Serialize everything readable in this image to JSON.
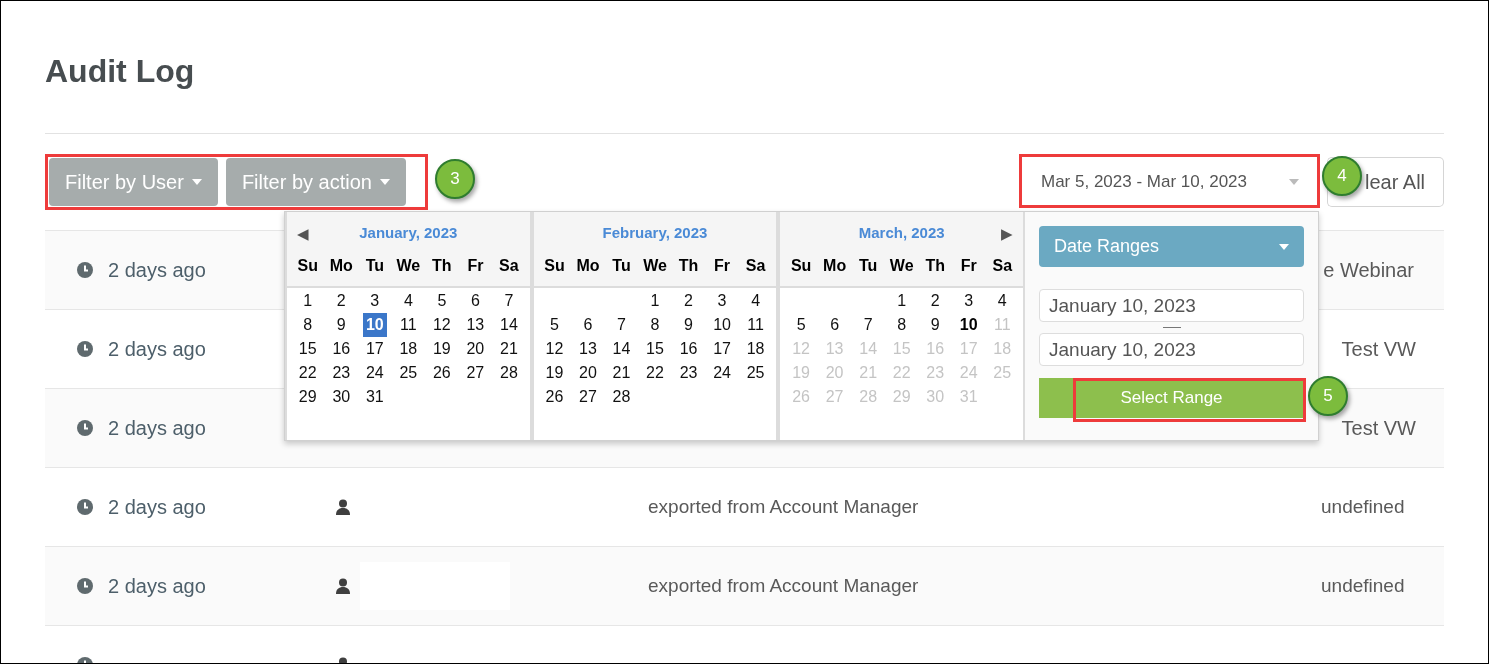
{
  "page": {
    "title": "Audit Log"
  },
  "toolbar": {
    "filters": [
      {
        "label": "Filter by User"
      },
      {
        "label": "Filter by action"
      }
    ],
    "date_range": {
      "value": "Mar 5, 2023 - Mar 10, 2023"
    },
    "clear_button": {
      "label": "lear All"
    }
  },
  "rows": [
    {
      "time": "2 days ago",
      "kind": "covered",
      "value": "e Webinar"
    },
    {
      "time": "2 days ago",
      "kind": "covered",
      "value": "Test VW"
    },
    {
      "time": "2 days ago",
      "kind": "covered",
      "value": "Test VW"
    },
    {
      "time": "2 days ago",
      "kind": "full",
      "action": "exported from Account Manager",
      "value": "undefined"
    },
    {
      "time": "2 days ago",
      "kind": "full",
      "action": "exported from Account Manager",
      "value": "undefined"
    },
    {
      "kind": "cut"
    }
  ],
  "date_picker": {
    "months": [
      {
        "title": "January, 2023",
        "prev": "◀",
        "weekdays": [
          "Su",
          "Mo",
          "Tu",
          "We",
          "Th",
          "Fr",
          "Sa"
        ],
        "weeks": [
          [
            {
              "kind": "day",
              "label": "1",
              "selected": false
            },
            {
              "kind": "day",
              "label": "2",
              "selected": false
            },
            {
              "kind": "day",
              "label": "3",
              "selected": false
            },
            {
              "kind": "day",
              "label": "4",
              "selected": false
            },
            {
              "kind": "day",
              "label": "5",
              "selected": false
            },
            {
              "kind": "day",
              "label": "6",
              "selected": false
            },
            {
              "kind": "day",
              "label": "7",
              "selected": false
            }
          ],
          [
            {
              "kind": "day",
              "label": "8",
              "selected": false
            },
            {
              "kind": "day",
              "label": "9",
              "selected": false
            },
            {
              "kind": "day",
              "label": "10",
              "selected": true
            },
            {
              "kind": "day",
              "label": "11",
              "selected": false
            },
            {
              "kind": "day",
              "label": "12",
              "selected": false
            },
            {
              "kind": "day",
              "label": "13",
              "selected": false
            },
            {
              "kind": "day",
              "label": "14",
              "selected": false
            }
          ],
          [
            {
              "kind": "day",
              "label": "15",
              "selected": false
            },
            {
              "kind": "day",
              "label": "16",
              "selected": false
            },
            {
              "kind": "day",
              "label": "17",
              "selected": false
            },
            {
              "kind": "day",
              "label": "18",
              "selected": false
            },
            {
              "kind": "day",
              "label": "19",
              "selected": false
            },
            {
              "kind": "day",
              "label": "20",
              "selected": false
            },
            {
              "kind": "day",
              "label": "21",
              "selected": false
            }
          ],
          [
            {
              "kind": "day",
              "label": "22",
              "selected": false
            },
            {
              "kind": "day",
              "label": "23",
              "selected": false
            },
            {
              "kind": "day",
              "label": "24",
              "selected": false
            },
            {
              "kind": "day",
              "label": "25",
              "selected": false
            },
            {
              "kind": "day",
              "label": "26",
              "selected": false
            },
            {
              "kind": "day",
              "label": "27",
              "selected": false
            },
            {
              "kind": "day",
              "label": "28",
              "selected": false
            }
          ],
          [
            {
              "kind": "day",
              "label": "29",
              "selected": false
            },
            {
              "kind": "day",
              "label": "30",
              "selected": false
            },
            {
              "kind": "day",
              "label": "31",
              "selected": false
            }
          ]
        ]
      },
      {
        "title": "February, 2023",
        "weekdays": [
          "Su",
          "Mo",
          "Tu",
          "We",
          "Th",
          "Fr",
          "Sa"
        ],
        "weeks": [
          [
            {
              "kind": "blank"
            },
            {
              "kind": "blank"
            },
            {
              "kind": "blank"
            },
            {
              "kind": "day",
              "label": "1",
              "selected": false
            },
            {
              "kind": "day",
              "label": "2",
              "selected": false
            },
            {
              "kind": "day",
              "label": "3",
              "selected": false
            },
            {
              "kind": "day",
              "label": "4",
              "selected": false
            }
          ],
          [
            {
              "kind": "day",
              "label": "5",
              "selected": false
            },
            {
              "kind": "day",
              "label": "6",
              "selected": false
            },
            {
              "kind": "day",
              "label": "7",
              "selected": false
            },
            {
              "kind": "day",
              "label": "8",
              "selected": false
            },
            {
              "kind": "day",
              "label": "9",
              "selected": false
            },
            {
              "kind": "day",
              "label": "10",
              "selected": false
            },
            {
              "kind": "day",
              "label": "11",
              "selected": false
            }
          ],
          [
            {
              "kind": "day",
              "label": "12",
              "selected": false
            },
            {
              "kind": "day",
              "label": "13",
              "selected": false
            },
            {
              "kind": "day",
              "label": "14",
              "selected": false
            },
            {
              "kind": "day",
              "label": "15",
              "selected": false
            },
            {
              "kind": "day",
              "label": "16",
              "selected": false
            },
            {
              "kind": "day",
              "label": "17",
              "selected": false
            },
            {
              "kind": "day",
              "label": "18",
              "selected": false
            }
          ],
          [
            {
              "kind": "day",
              "label": "19",
              "selected": false
            },
            {
              "kind": "day",
              "label": "20",
              "selected": false
            },
            {
              "kind": "day",
              "label": "21",
              "selected": false
            },
            {
              "kind": "day",
              "label": "22",
              "selected": false
            },
            {
              "kind": "day",
              "label": "23",
              "selected": false
            },
            {
              "kind": "day",
              "label": "24",
              "selected": false
            },
            {
              "kind": "day",
              "label": "25",
              "selected": false
            }
          ],
          [
            {
              "kind": "day",
              "label": "26",
              "selected": false
            },
            {
              "kind": "day",
              "label": "27",
              "selected": false
            },
            {
              "kind": "day",
              "label": "28",
              "selected": false
            }
          ]
        ]
      },
      {
        "title": "March, 2023",
        "next": "▶",
        "weekdays": [
          "Su",
          "Mo",
          "Tu",
          "We",
          "Th",
          "Fr",
          "Sa"
        ],
        "weeks": [
          [
            {
              "kind": "blank"
            },
            {
              "kind": "blank"
            },
            {
              "kind": "blank"
            },
            {
              "kind": "day",
              "label": "1",
              "selected": false
            },
            {
              "kind": "day",
              "label": "2",
              "selected": false
            },
            {
              "kind": "day",
              "label": "3",
              "selected": false
            },
            {
              "kind": "day",
              "label": "4",
              "selected": false
            }
          ],
          [
            {
              "kind": "day",
              "label": "5",
              "selected": false
            },
            {
              "kind": "day",
              "label": "6",
              "selected": false
            },
            {
              "kind": "day",
              "label": "7",
              "selected": false
            },
            {
              "kind": "day",
              "label": "8",
              "selected": false
            },
            {
              "kind": "day",
              "label": "9",
              "selected": false
            },
            {
              "kind": "today",
              "label": "10",
              "selected": false
            },
            {
              "kind": "disabled",
              "label": "11",
              "selected": false
            }
          ],
          [
            {
              "kind": "disabled",
              "label": "12",
              "selected": false
            },
            {
              "kind": "disabled",
              "label": "13",
              "selected": false
            },
            {
              "kind": "disabled",
              "label": "14",
              "selected": false
            },
            {
              "kind": "disabled",
              "label": "15",
              "selected": false
            },
            {
              "kind": "disabled",
              "label": "16",
              "selected": false
            },
            {
              "kind": "disabled",
              "label": "17",
              "selected": false
            },
            {
              "kind": "disabled",
              "label": "18",
              "selected": false
            }
          ],
          [
            {
              "kind": "disabled",
              "label": "19",
              "selected": false
            },
            {
              "kind": "disabled",
              "label": "20",
              "selected": false
            },
            {
              "kind": "disabled",
              "label": "21",
              "selected": false
            },
            {
              "kind": "disabled",
              "label": "22",
              "selected": false
            },
            {
              "kind": "disabled",
              "label": "23",
              "selected": false
            },
            {
              "kind": "disabled",
              "label": "24",
              "selected": false
            },
            {
              "kind": "disabled",
              "label": "25",
              "selected": false
            }
          ],
          [
            {
              "kind": "disabled",
              "label": "26",
              "selected": false
            },
            {
              "kind": "disabled",
              "label": "27",
              "selected": false
            },
            {
              "kind": "disabled",
              "label": "28",
              "selected": false
            },
            {
              "kind": "disabled",
              "label": "29",
              "selected": false
            },
            {
              "kind": "disabled",
              "label": "30",
              "selected": false
            },
            {
              "kind": "disabled",
              "label": "31",
              "selected": false
            }
          ]
        ]
      }
    ],
    "ranges_dropdown": {
      "label": "Date Ranges"
    },
    "start_date": {
      "value": "January 10, 2023"
    },
    "end_date": {
      "value": "January 10, 2023"
    },
    "apply_button": {
      "label": "Select Range"
    }
  },
  "callouts": [
    {
      "label": "3"
    },
    {
      "label": "4"
    },
    {
      "label": "5"
    }
  ]
}
